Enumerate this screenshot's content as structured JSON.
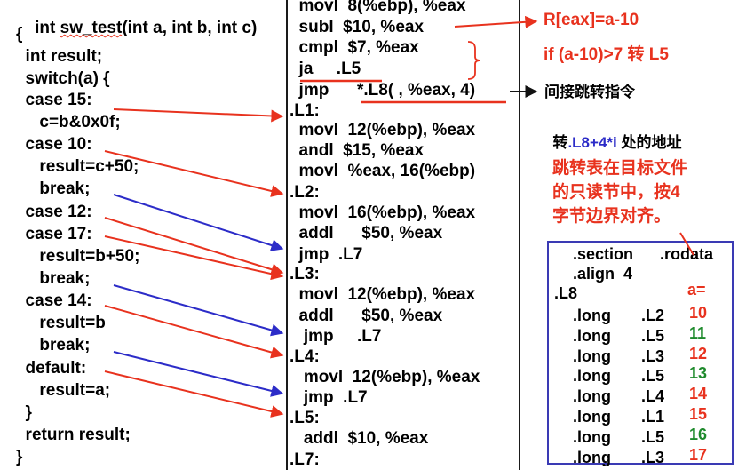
{
  "c_code": [
    "int sw_test(int a, int b, int c)",
    "{",
    "  int result;",
    "  switch(a) {",
    "  case 15:",
    "     c=b&0x0f;",
    "  case 10:",
    "     result=c+50;",
    "     break;",
    "  case 12:",
    "  case 17:",
    "     result=b+50;",
    "     break;",
    "  case 14:",
    "     result=b",
    "     break;",
    "  default:",
    "     result=a;",
    "  }",
    "  return result;",
    "}"
  ],
  "asm_code": [
    "  movl  8(%ebp), %eax",
    "  subl  $10, %eax",
    "  cmpl  $7, %eax",
    "  ja     .L5",
    "  jmp      *.L8( , %eax, 4)",
    ".L1:",
    "  movl  12(%ebp), %eax",
    "  andl  $15, %eax",
    "  movl  %eax, 16(%ebp)",
    ".L2:",
    "  movl  16(%ebp), %eax",
    "  addl      $50, %eax",
    "  jmp  .L7",
    ".L3:",
    "  movl  12(%ebp), %eax",
    "  addl      $50, %eax",
    "   jmp     .L7",
    ".L4:",
    "   movl  12(%ebp), %eax",
    "   jmp  .L7",
    ".L5:",
    "   addl  $10, %eax",
    ".L7:"
  ],
  "annotations": {
    "r_eax": "R[eax]=a-10",
    "if_cond": "if (a-10)>7 转 L5",
    "indirect_jump": "间接跳转指令",
    "goto_prefix": "转",
    "goto_addr": ".L8+4*i",
    "goto_suffix": " 处的地址",
    "jump_table_note": [
      "跳转表在目标文件",
      "的只读节中，按4",
      "字节边界对齐。"
    ]
  },
  "rodata": {
    "section_kw": ".section",
    "section_name": ".rodata",
    "align": ".align  4",
    "label": ".L8",
    "a_header": "a=",
    "entries": [
      {
        "directive": ".long",
        "target": ".L2",
        "a": "10",
        "color": "#e8321e"
      },
      {
        "directive": ".long",
        "target": ".L5",
        "a": "11",
        "color": "#1e8a2c"
      },
      {
        "directive": ".long",
        "target": ".L3",
        "a": "12",
        "color": "#e8321e"
      },
      {
        "directive": ".long",
        "target": ".L5",
        "a": "13",
        "color": "#1e8a2c"
      },
      {
        "directive": ".long",
        "target": ".L4",
        "a": "14",
        "color": "#e8321e"
      },
      {
        "directive": ".long",
        "target": ".L1",
        "a": "15",
        "color": "#e8321e"
      },
      {
        "directive": ".long",
        "target": ".L5",
        "a": "16",
        "color": "#1e8a2c"
      },
      {
        "directive": ".long",
        "target": ".L3",
        "a": "17",
        "color": "#e8321e"
      }
    ]
  },
  "colors": {
    "red": "#e8321e",
    "blue": "#2c2cc8",
    "green": "#1e8a2c",
    "box_border": "#3a3ab4"
  }
}
